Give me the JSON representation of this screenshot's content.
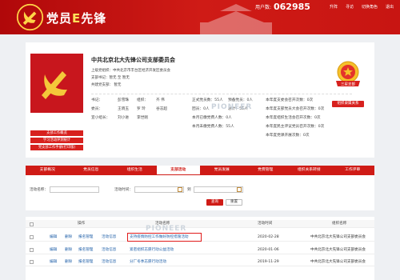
{
  "header": {
    "title_part1": "党员",
    "title_e": "E",
    "title_part2": "先锋",
    "user_label": "用户数:",
    "user_count": "062985",
    "links": [
      "升阵",
      "寻访",
      "切换角色",
      "退出"
    ]
  },
  "org": {
    "name": "中共北京北大先锋公司支部委员会",
    "superior": "上级党组织：中共北京市丰台区经济开发区委员会",
    "secretary_label": "支部书记：暂无  至  暂无",
    "co_build": "共建党支部：  暂无"
  },
  "badge": {
    "title": "三星支部",
    "button": "组织隶属关系"
  },
  "members_grid": [
    [
      "书记：",
      "彭雪珠",
      "组织：",
      "齐  伟"
    ],
    [
      "委员：",
      "王晓玉",
      "罗  玲",
      "谷志超"
    ],
    [
      "宣小组长：",
      "刘小进",
      "李世刚",
      ""
    ]
  ],
  "stats": [
    [
      "正式党员数：55人",
      "预备党员：0人"
    ],
    [
      "团员：0人",
      "总计：55人"
    ],
    [
      "本月已缴党费人数：0人",
      ""
    ],
    [
      "本月未缴党费人数：55人",
      ""
    ]
  ],
  "meetings": [
    "本年度支委会召开次数：0次",
    "本年度支部党员大会召开次数：0次",
    "本年度组织生活会召开次数：0次",
    "本年度民主评议党员召开次数：0次",
    "本年度党课开展次数：0次"
  ],
  "watermark": "PIONEER",
  "sidebar_buttons": [
    "支部工作概览",
    "学习活动评测统计",
    "党支部工作手册(打印版)"
  ],
  "nav": {
    "items": [
      "支部概况",
      "党员信息",
      "组织生活",
      "支部活动",
      "党员发展",
      "党费管理",
      "组织关系转接",
      "工作评审"
    ],
    "active_index": 3
  },
  "search": {
    "activity_name_label": "活动名称：",
    "activity_time_label": "活动时间：",
    "to_label": "到",
    "query_button": "查询",
    "reset_button": "重置"
  },
  "table": {
    "headers": [
      "操作",
      "活动名称",
      "活动时间",
      "组织名称"
    ],
    "actions": [
      "编辑",
      "删除",
      "报名管理",
      "活动信息"
    ],
    "rows": [
      {
        "name": "支持疫情防控工作做好防控措施活动",
        "date": "2020-02-28",
        "org": "中共北京北大先锋公司支部委员会"
      },
      {
        "name": "紧密组织志愿行动公益活动",
        "date": "2020-01-06",
        "org": "中共北京北大先锋公司支部委员会"
      },
      {
        "name": "分厂冬季志愿行动活动",
        "date": "2019-11-29",
        "org": "中共北京北大先锋公司支部委员会"
      }
    ]
  },
  "colors": {
    "accent": "#cf1b16",
    "link": "#1f5fa8",
    "highlight": "#e01a1a"
  }
}
